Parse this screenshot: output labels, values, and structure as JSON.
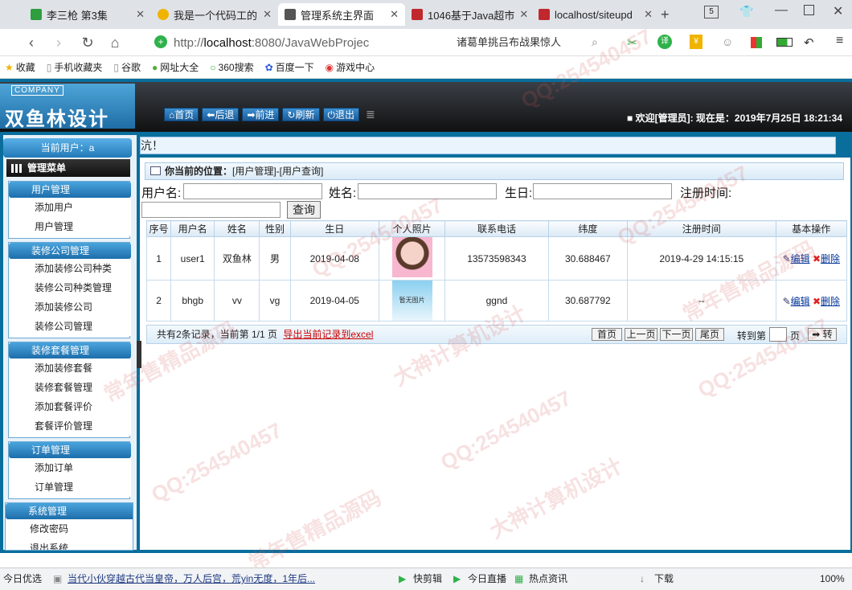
{
  "browser": {
    "tabs": [
      {
        "title": "李三枪 第3集",
        "color": "#2e9e3f"
      },
      {
        "title": "我是一个代码工的",
        "color": "#f0b400"
      },
      {
        "title": "管理系统主界面",
        "color": "#555555"
      },
      {
        "title": "1046基于Java超市",
        "color": "#c0282d"
      },
      {
        "title": "localhost/siteupd",
        "color": "#c0282d"
      }
    ],
    "tab_count": "5",
    "url_prefix": "http://",
    "url_host": "localhost",
    "url_rest": ":8080/JavaWebProjec",
    "search_text": "诸葛单挑吕布战果惊人",
    "bookmarks": [
      "收藏",
      "手机收藏夹",
      "谷歌",
      "网址大全",
      "360搜索",
      "百度一下",
      "游戏中心"
    ]
  },
  "app": {
    "company": "COMPANY",
    "logo_text": "双鱼林设计",
    "nav": [
      "首页",
      "后退",
      "前进",
      "刷新",
      "退出"
    ],
    "welcome": "■ 欢迎[管理员]:  现在是：2019年7月25日 18:21:34",
    "current_user": "当前用户：a",
    "marquee": "沆！",
    "menu_title": "管理菜单",
    "menu": [
      {
        "group": "用户管理",
        "items": [
          "添加用户",
          "用户管理"
        ]
      },
      {
        "group": "装修公司管理",
        "items": [
          "添加装修公司种类",
          "装修公司种类管理",
          "添加装修公司",
          "装修公司管理"
        ]
      },
      {
        "group": "装修套餐管理",
        "items": [
          "添加装修套餐",
          "装修套餐管理",
          "添加套餐评价",
          "套餐评价管理"
        ]
      },
      {
        "group": "订单管理",
        "items": [
          "添加订单",
          "订单管理"
        ]
      },
      {
        "group": "系统管理",
        "items": [
          "修改密码",
          "退出系统"
        ]
      }
    ],
    "breadcrumb_label": "你当前的位置：",
    "breadcrumb_path": "[用户管理]-[用户查询]",
    "search": {
      "username_label": "用户名:",
      "name_label": "姓名:",
      "birthday_label": "生日:",
      "regtime_label": "注册时间:",
      "username_value": "",
      "name_value": "",
      "birthday_value": "",
      "regtime_value": "",
      "button": "查询"
    },
    "table": {
      "headers": [
        "序号",
        "用户名",
        "姓名",
        "性别",
        "生日",
        "个人照片",
        "联系电话",
        "纬度",
        "注册时间",
        "基本操作"
      ],
      "rows": [
        {
          "no": "1",
          "username": "user1",
          "name": "双鱼林",
          "sex": "男",
          "birthday": "2019-04-08",
          "photo": "",
          "phone": "13573598343",
          "lat": "30.688467",
          "regtime": "2019-4-29 14:15:15"
        },
        {
          "no": "2",
          "username": "bhgb",
          "name": "vv",
          "sex": "vg",
          "birthday": "2019-04-05",
          "photo": "暂无图片",
          "phone": "ggnd",
          "lat": "30.687792",
          "regtime": "--"
        }
      ],
      "edit": "编辑",
      "delete": "删除"
    },
    "pager": {
      "summary": "共有2条记录，当前第 1/1 页",
      "export": "导出当前记录到excel",
      "first": "首页",
      "prev": "上一页",
      "next": "下一页",
      "last": "尾页",
      "goto_label": "转到第",
      "page_unit": "页",
      "goto_btn": "➡ 转"
    }
  },
  "statusbar": {
    "left": "今日优选",
    "news": "当代小伙穿越古代当皇帝，万人后宫，荒yin无度，1年后...",
    "items": [
      "快剪辑",
      "今日直播",
      "热点资讯",
      "下载"
    ],
    "zoom": "100%"
  },
  "watermarks": [
    "QQ:254540457",
    "常年售精品源码",
    "大神计算机设计"
  ]
}
